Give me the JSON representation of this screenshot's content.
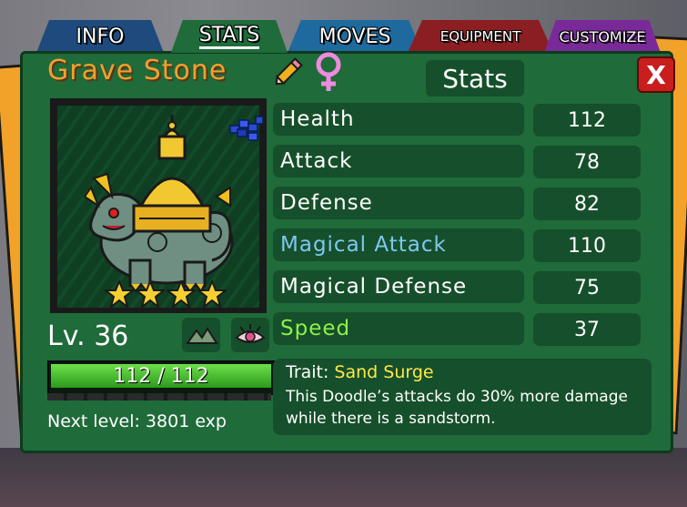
{
  "tabs": [
    {
      "label": "INFO"
    },
    {
      "label": "STATS"
    },
    {
      "label": "MOVES"
    },
    {
      "label": "EQUIPMENT"
    },
    {
      "label": "CUSTOMIZE"
    }
  ],
  "active_tab": "STATS",
  "doodle": {
    "name": "Grave Stone",
    "gender": "female",
    "level": "Lv. 36",
    "stars": 4,
    "hp_current": 112,
    "hp_max": 112,
    "hp_text": "112 / 112",
    "hp_fraction": 1.0,
    "next_level": "Next level: 3801 exp"
  },
  "stats_header": "Stats",
  "close_label": "X",
  "stats": [
    {
      "label": "Health",
      "value": "112",
      "color": "#ffffff"
    },
    {
      "label": "Attack",
      "value": "78",
      "color": "#ffffff"
    },
    {
      "label": "Defense",
      "value": "82",
      "color": "#ffffff"
    },
    {
      "label": "Magical Attack",
      "value": "110",
      "color": "#7ec8f0"
    },
    {
      "label": "Magical Defense",
      "value": "75",
      "color": "#ffffff"
    },
    {
      "label": "Speed",
      "value": "37",
      "color": "#8ef04a"
    }
  ],
  "trait": {
    "prefix": "Trait:",
    "name": "Sand Surge",
    "description": "This Doodle’s attacks do 30% more damage while there is a sandstorm."
  },
  "colors": {
    "panel": "#1f6b3a",
    "row": "#164f2b",
    "name": "#f0a030",
    "trait_name": "#ffe84a",
    "close": "#c81e1e"
  },
  "icons": [
    "pencil-icon",
    "female-icon",
    "gem-icon",
    "mountain-icon",
    "eye-icon",
    "star-icon",
    "close-icon"
  ]
}
